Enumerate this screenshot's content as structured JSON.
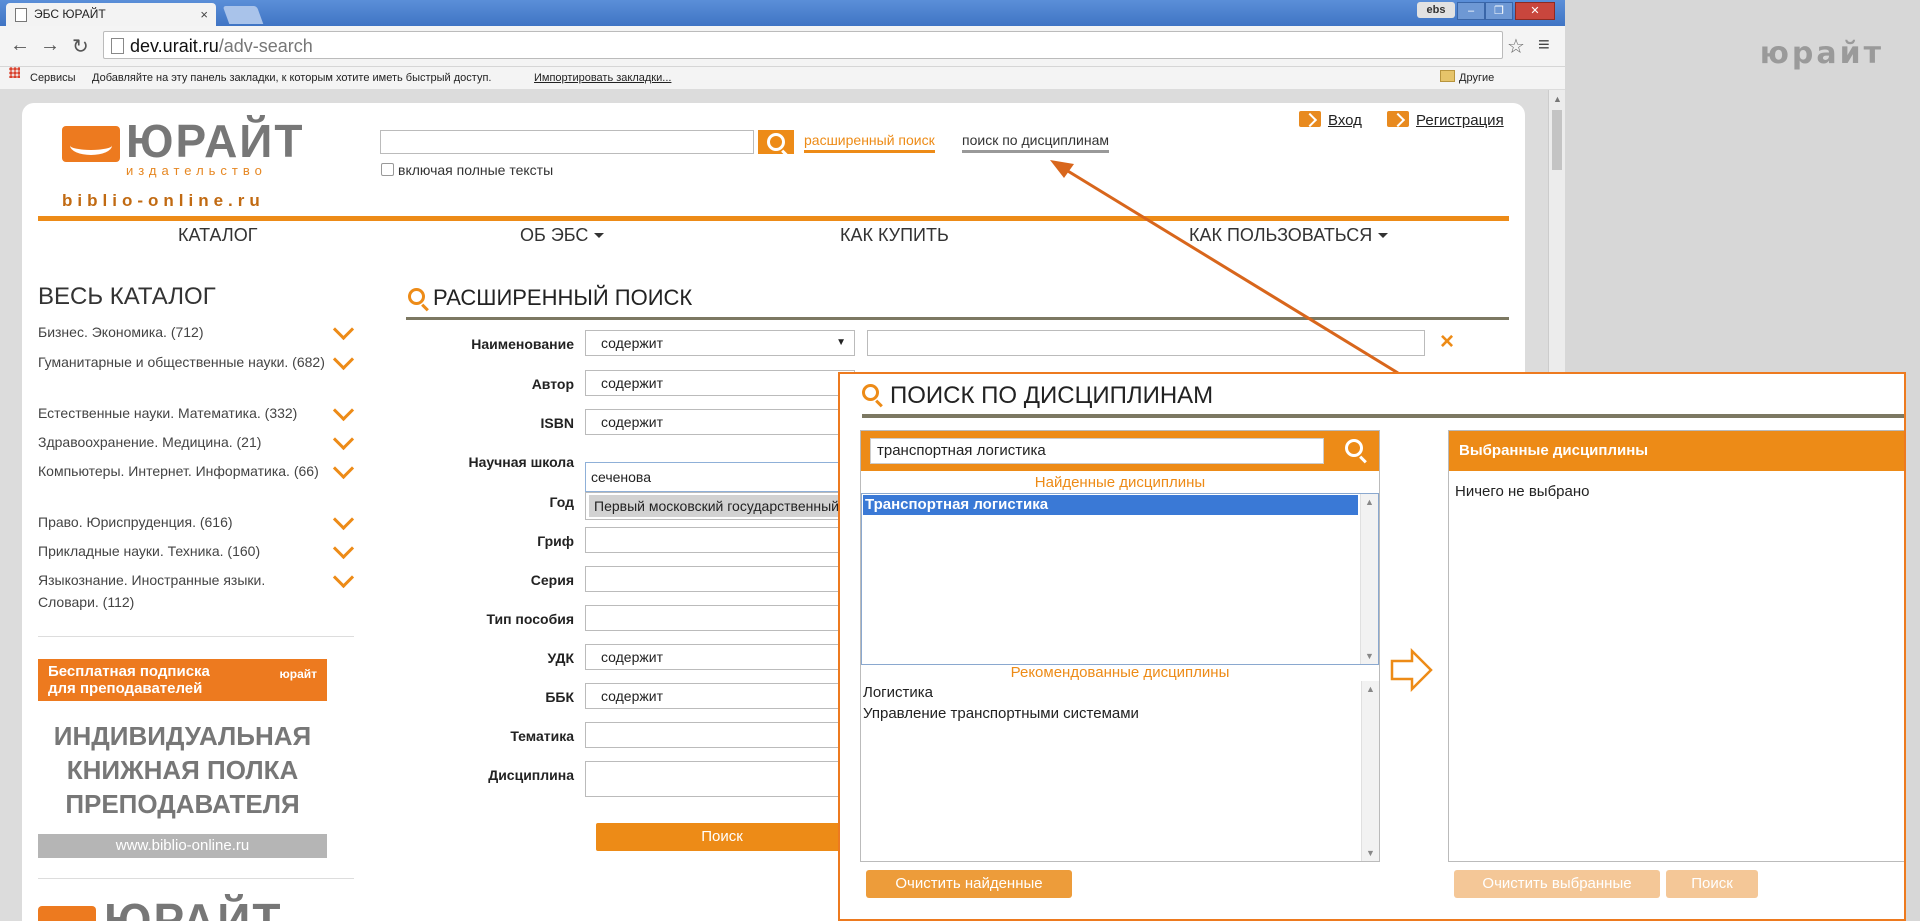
{
  "corner_brand": "юрайт",
  "browser": {
    "tab_title": "ЭБС ЮРАЙТ",
    "tab_close": "×",
    "profile_badge": "ebs",
    "url_host": "dev.urait.ru",
    "url_path": "/adv-search",
    "bookmarks": {
      "apps": "Сервисы",
      "hint": "Добавляйте на эту панель закладки, к которым хотите иметь быстрый доступ.",
      "import": "Импортировать закладки...",
      "other": "Другие закладки"
    }
  },
  "header": {
    "logo_name": "ЮРАЙТ",
    "logo_sub": "издательство",
    "logo_url": "biblio-online.ru",
    "search_placeholder": "",
    "adv_search": "расширенный поиск",
    "discipline_search": "поиск по дисциплинам",
    "full_texts": "включая полные тексты",
    "login": "Вход",
    "register": "Регистрация"
  },
  "nav": [
    "КАТАЛОГ",
    "ОБ ЭБС",
    "КАК КУПИТЬ",
    "КАК ПОЛЬЗОВАТЬСЯ"
  ],
  "sidebar": {
    "title": "ВЕСЬ КАТАЛОГ",
    "items": [
      "Бизнес. Экономика. (712)",
      "Гуманитарные и общественные науки. (682)",
      "Естественные науки. Математика. (332)",
      "Здравоохранение. Медицина. (21)",
      "Компьютеры. Интернет. Информатика. (66)",
      "Право. Юриспруденция. (616)",
      "Прикладные науки. Техника. (160)",
      "Языкознание. Иностранные языки. Словари. (112)"
    ],
    "promo_top": "Бесплатная подписка для преподавателей",
    "promo_brand": "юрайт",
    "promo_big": "ИНДИВИДУАЛЬНАЯ КНИЖНАЯ ПОЛКА ПРЕПОДАВАТЕЛЯ",
    "promo_url": "www.biblio-online.ru",
    "bottom_logo": "ЮРАЙТ"
  },
  "adv": {
    "title": "РАСШИРЕННЫЙ ПОИСК",
    "labels": {
      "name": "Наименование",
      "author": "Автор",
      "isbn": "ISBN",
      "school": "Научная школа",
      "year": "Год",
      "grif": "Гриф",
      "series": "Серия",
      "type": "Тип пособия",
      "udk": "УДК",
      "bbk": "ББК",
      "theme": "Тематика",
      "discipline": "Дисциплина"
    },
    "contains": "содержит",
    "school_value": "сеченова",
    "suggestion": "Первый московский государственный",
    "submit": "Поиск",
    "clear": "×"
  },
  "overlay": {
    "title": "ПОИСК ПО ДИСЦИПЛИНАМ",
    "query": "транспортная логистика",
    "found_label": "Найденные дисциплины",
    "found": [
      "Транспортная логистика"
    ],
    "recommended_label": "Рекомендованные дисциплины",
    "recommended": [
      "Логистика",
      "Управление транспортными системами"
    ],
    "selected_title": "Выбранные дисциплины",
    "selected_empty": "Ничего не выбрано",
    "btn_clear_found": "Очистить найденные",
    "btn_clear_selected": "Очистить выбранные",
    "btn_search": "Поиск"
  },
  "colors": {
    "accent": "#ed8b17",
    "selection": "#3a79d6",
    "rule": "#7c7862"
  }
}
